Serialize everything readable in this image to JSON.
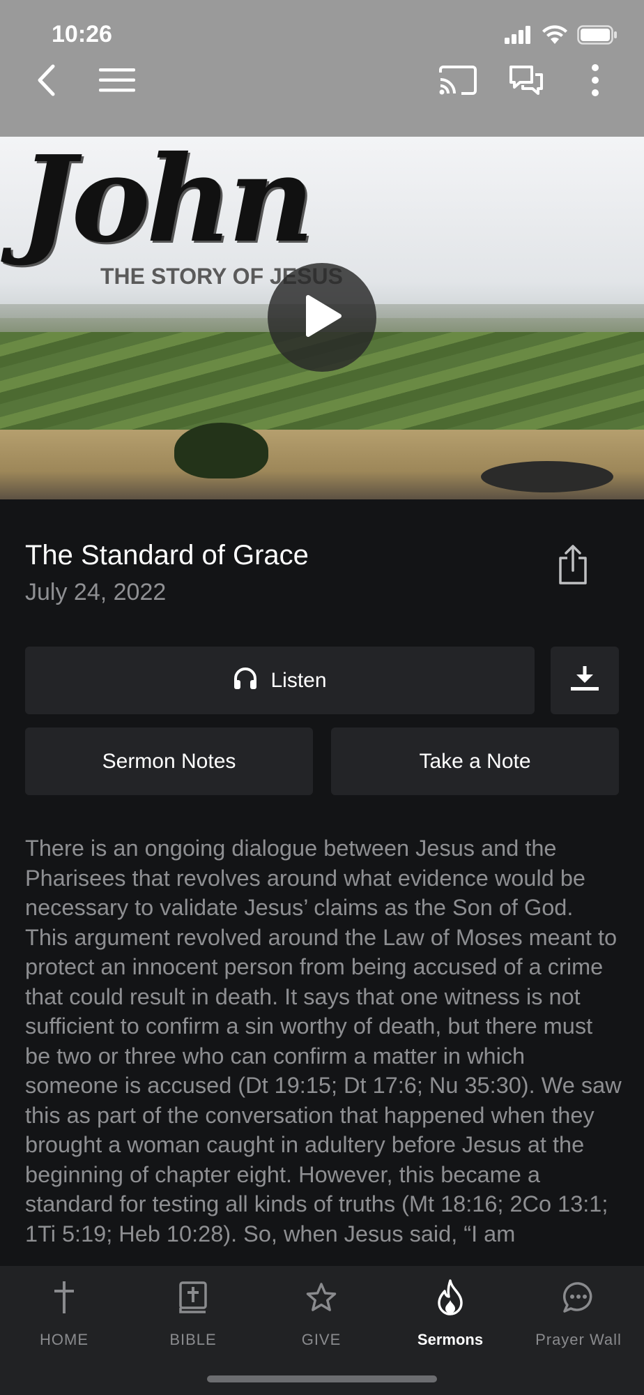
{
  "status_bar": {
    "time": "10:26"
  },
  "nav": {
    "back_icon": "chevron-left-icon",
    "menu_icon": "hamburger-menu-icon",
    "cast_icon": "cast-icon",
    "chat_icon": "chat-bubbles-icon",
    "more_icon": "vertical-dots-icon"
  },
  "hero": {
    "title": "John",
    "subtitle": "THE STORY OF JESUS"
  },
  "sermon": {
    "title": "The Standard of Grace",
    "date": "July 24, 2022"
  },
  "actions": {
    "listen_label": "Listen",
    "sermon_notes_label": "Sermon Notes",
    "take_note_label": "Take a Note"
  },
  "description": "There is an ongoing dialogue between Jesus and the Pharisees that revolves around what evidence would be necessary to validate Jesus’ claims as the Son of God. This argument revolved around the Law of Moses meant to protect an innocent person from being accused of a crime that could result in death. It says that one witness is not sufficient to confirm a sin worthy of death, but there must be two or three who can confirm a matter in which someone is accused (Dt 19:15; Dt 17:6; Nu 35:30). We saw this as part of the conversation that happened when they brought a woman caught in adultery before Jesus at the beginning of chapter eight. However, this became a standard for testing all kinds of truths (Mt 18:16; 2Co 13:1; 1Ti 5:19; Heb 10:28). So, when Jesus said, “I am",
  "tabs": [
    {
      "label": "HOME",
      "icon": "cross-icon",
      "active": false
    },
    {
      "label": "BIBLE",
      "icon": "bible-icon",
      "active": false
    },
    {
      "label": "GIVE",
      "icon": "star-icon",
      "active": false
    },
    {
      "label": "Sermons",
      "icon": "flame-icon",
      "active": true
    },
    {
      "label": "Prayer Wall",
      "icon": "chat-bubble-icon",
      "active": false
    }
  ],
  "colors": {
    "background": "#131416",
    "button_bg": "#232427",
    "topbar": "#9a9a9a",
    "muted_text": "#8e8f92",
    "tabbar": "#212224"
  }
}
